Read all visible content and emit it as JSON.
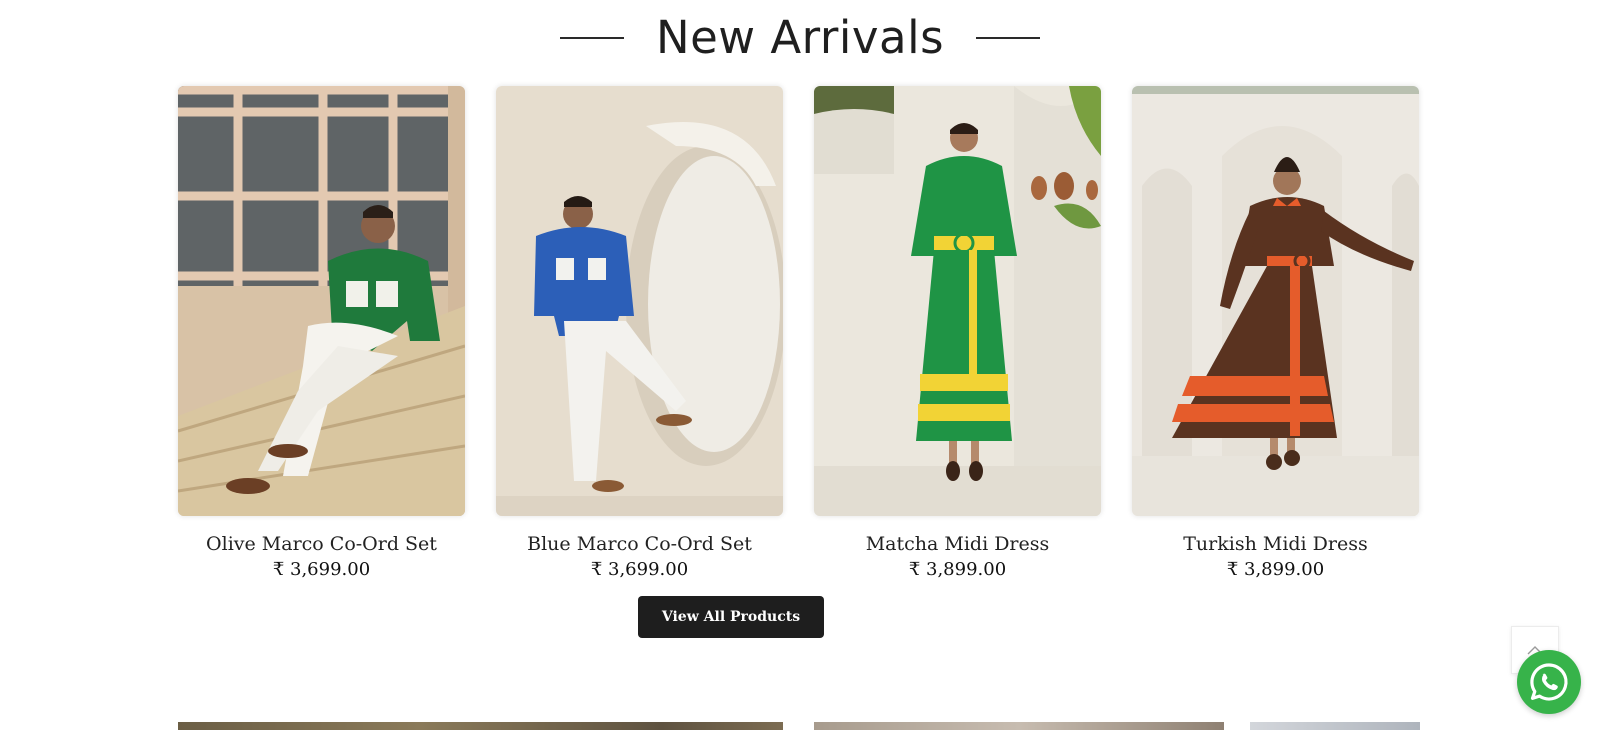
{
  "section": {
    "title": "New Arrivals"
  },
  "products": [
    {
      "name": "Olive Marco Co-Ord Set",
      "price": "₹ 3,699.00",
      "image_alt": "Man in green shirt with white pockets sitting on stone steps"
    },
    {
      "name": "Blue Marco Co-Ord Set",
      "price": "₹ 3,699.00",
      "image_alt": "Man in blue shirt with white pockets leaning on arched wall"
    },
    {
      "name": "Matcha Midi Dress",
      "price": "₹ 3,899.00",
      "image_alt": "Woman in green midi dress with yellow belt and stripes"
    },
    {
      "name": "Turkish Midi Dress",
      "price": "₹ 3,899.00",
      "image_alt": "Woman in brown midi dress with orange belt and stripes"
    }
  ],
  "cta": {
    "view_all_label": "View All Products"
  },
  "floating": {
    "back_to_top_icon": "chevron-up-icon",
    "whatsapp_icon": "whatsapp-icon"
  },
  "colors": {
    "button_bg": "#1e1e1e",
    "whatsapp_green": "#37b34a"
  }
}
